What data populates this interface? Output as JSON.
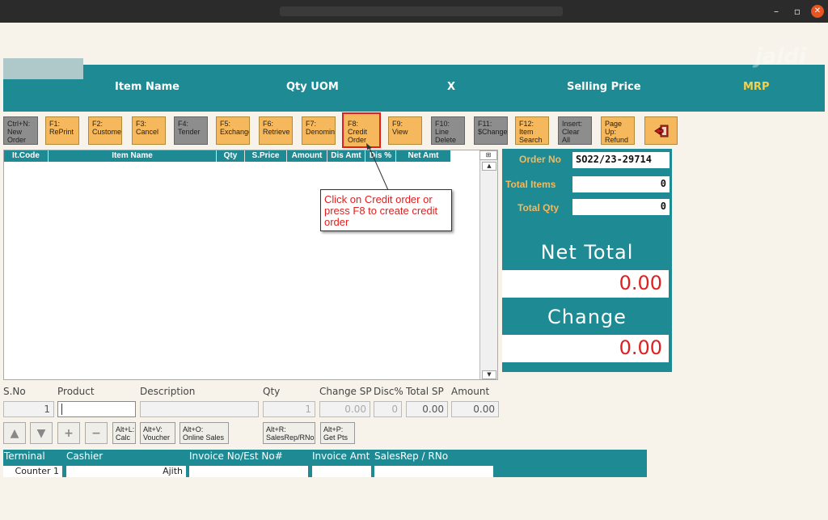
{
  "window": {
    "minimize": "–",
    "restore": "▫",
    "close": "✕"
  },
  "header": {
    "brand_watermark": "jaldi",
    "columns": {
      "item_name": "Item Name",
      "qty_uom": "Qty UOM",
      "x": "X",
      "selling_price": "Selling Price",
      "mrp": "MRP"
    },
    "mrp_color": "#f2d24b"
  },
  "fkeys": [
    {
      "l1": "Ctrl+N:",
      "l2": "New",
      "l3": "Order"
    },
    {
      "l1": "F1:",
      "l2": "RePrint",
      "l3": ""
    },
    {
      "l1": "F2:",
      "l2": "Customer",
      "l3": ""
    },
    {
      "l1": "F3:",
      "l2": "Cancel",
      "l3": ""
    },
    {
      "l1": "F4:",
      "l2": "Tender",
      "l3": ""
    },
    {
      "l1": "F5:",
      "l2": "Exchange",
      "l3": ""
    },
    {
      "l1": "F6:",
      "l2": "Retrieve",
      "l3": ""
    },
    {
      "l1": "F7:",
      "l2": "Denomina",
      "l3": ""
    },
    {
      "l1": "F8:",
      "l2": "Credit",
      "l3": "Order"
    },
    {
      "l1": "F9:",
      "l2": "View",
      "l3": ""
    },
    {
      "l1": "F10:",
      "l2": "Line",
      "l3": "Delete"
    },
    {
      "l1": "F11:",
      "l2": "$Change",
      "l3": ""
    },
    {
      "l1": "F12:",
      "l2": "Item",
      "l3": "Search"
    },
    {
      "l1": "Insert:",
      "l2": "Clear All",
      "l3": ""
    },
    {
      "l1": "Page Up:",
      "l2": "Refund",
      "l3": ""
    }
  ],
  "grid": {
    "columns": [
      "It.Code",
      "Item Name",
      "Qty",
      "S.Price",
      "Amount",
      "Dis Amt",
      "Dis %",
      "Net Amt"
    ]
  },
  "callout": {
    "text": "Click on Credit order or press F8 to create credit order"
  },
  "summary": {
    "order_no_label": "Order No",
    "order_no": "SO22/23-29714",
    "total_items_label": "Total Items",
    "total_items": "0",
    "total_qty_label": "Total Qty",
    "total_qty": "0",
    "net_total_label": "Net Total",
    "net_total": "0.00",
    "change_label": "Change",
    "change": "0.00"
  },
  "entry": {
    "labels": {
      "sno": "S.No",
      "product": "Product",
      "description": "Description",
      "qty": "Qty",
      "change_sp": "Change SP",
      "disc": "Disc%",
      "total_sp": "Total SP",
      "amount": "Amount"
    },
    "values": {
      "sno": "1",
      "product": "",
      "description": "",
      "qty": "1",
      "change_sp": "0.00",
      "disc": "0",
      "total_sp": "0.00",
      "amount": "0.00"
    }
  },
  "buttons": {
    "calc": {
      "l1": "Alt+L:",
      "l2": "Calc"
    },
    "voucher": {
      "l1": "Alt+V:",
      "l2": "Voucher"
    },
    "online": {
      "l1": "Alt+O:",
      "l2": "Online Sales"
    },
    "salesrep": {
      "l1": "Alt+R:",
      "l2": "SalesRep/RNo"
    },
    "getpts": {
      "l1": "Alt+P:",
      "l2": "Get Pts"
    }
  },
  "footer": {
    "labels": {
      "terminal": "Terminal",
      "cashier": "Cashier",
      "invoice_no": "Invoice No/Est No#",
      "invoice_amt": "Invoice Amt",
      "salesrep": "SalesRep / RNo"
    },
    "values": {
      "terminal": "Counter 1",
      "cashier": "Ajith",
      "invoice_no": "",
      "invoice_amt": "",
      "salesrep": ""
    }
  },
  "colors": {
    "teal": "#1e8a93",
    "orange": "#f5b85c",
    "red": "#e02020"
  }
}
